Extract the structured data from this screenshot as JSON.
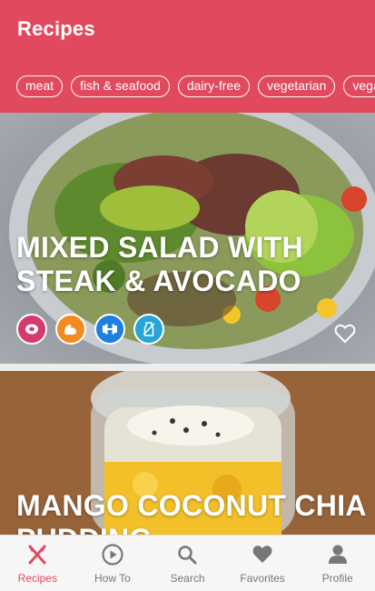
{
  "header": {
    "title": "Recipes"
  },
  "filters": [
    "meat",
    "fish & seafood",
    "dairy-free",
    "vegetarian",
    "vegan"
  ],
  "cards": [
    {
      "title": "Mixed salad with steak & avocado",
      "tags": [
        {
          "icon": "steak-icon",
          "color": "#d43a6e"
        },
        {
          "icon": "muscle-icon",
          "color": "#f58a1f"
        },
        {
          "icon": "dumbbell-icon",
          "color": "#1f7fe0"
        },
        {
          "icon": "no-dairy-icon",
          "color": "#25a6d9"
        }
      ]
    },
    {
      "title": "Mango coconut chia pudding"
    }
  ],
  "nav": [
    {
      "label": "Recipes",
      "icon": "fork-knife-icon",
      "active": true
    },
    {
      "label": "How To",
      "icon": "play-icon",
      "active": false
    },
    {
      "label": "Search",
      "icon": "search-icon",
      "active": false
    },
    {
      "label": "Favorites",
      "icon": "heart-icon",
      "active": false
    },
    {
      "label": "Profile",
      "icon": "profile-icon",
      "active": false
    }
  ],
  "colors": {
    "accent": "#e14a5e",
    "inactive": "#777777"
  }
}
